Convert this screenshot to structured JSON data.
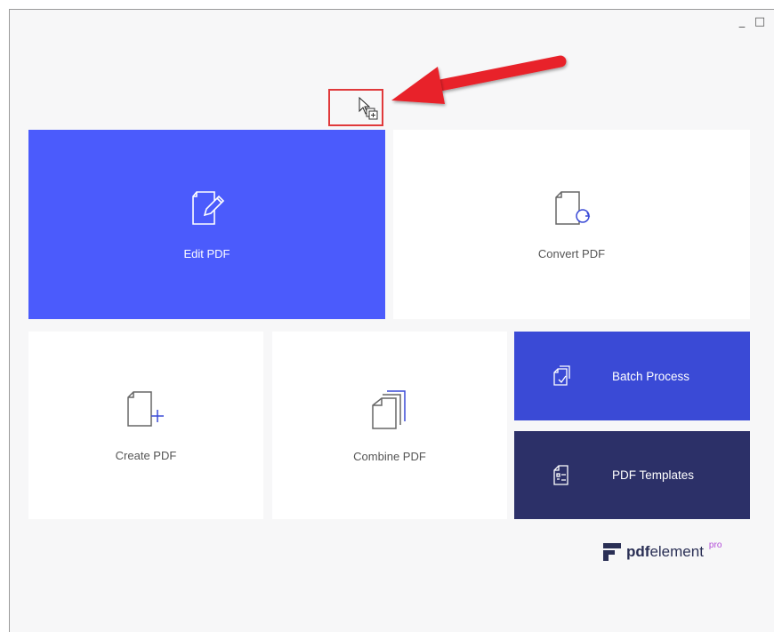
{
  "window": {
    "controls": {
      "minimize": "_",
      "maximize": "□",
      "close": "×"
    }
  },
  "tiles": {
    "edit": {
      "label": "Edit PDF",
      "icon": "edit-document-icon",
      "color": "#4b5bfc"
    },
    "convert": {
      "label": "Convert PDF",
      "icon": "convert-document-icon",
      "color": "#ffffff"
    },
    "create": {
      "label": "Create PDF",
      "icon": "create-document-icon",
      "color": "#ffffff"
    },
    "combine": {
      "label": "Combine PDF",
      "icon": "combine-documents-icon",
      "color": "#ffffff"
    },
    "batch": {
      "label": "Batch Process",
      "icon": "batch-process-icon",
      "color": "#3a4ad6"
    },
    "templates": {
      "label": "PDF Templates",
      "icon": "pdf-templates-icon",
      "color": "#2c3068"
    }
  },
  "brand": {
    "bold": "pdf",
    "rest": "element",
    "suffix": "pro"
  },
  "annotation": {
    "highlight_color": "#e0393b",
    "target": "drag-copy-cursor-icon"
  }
}
